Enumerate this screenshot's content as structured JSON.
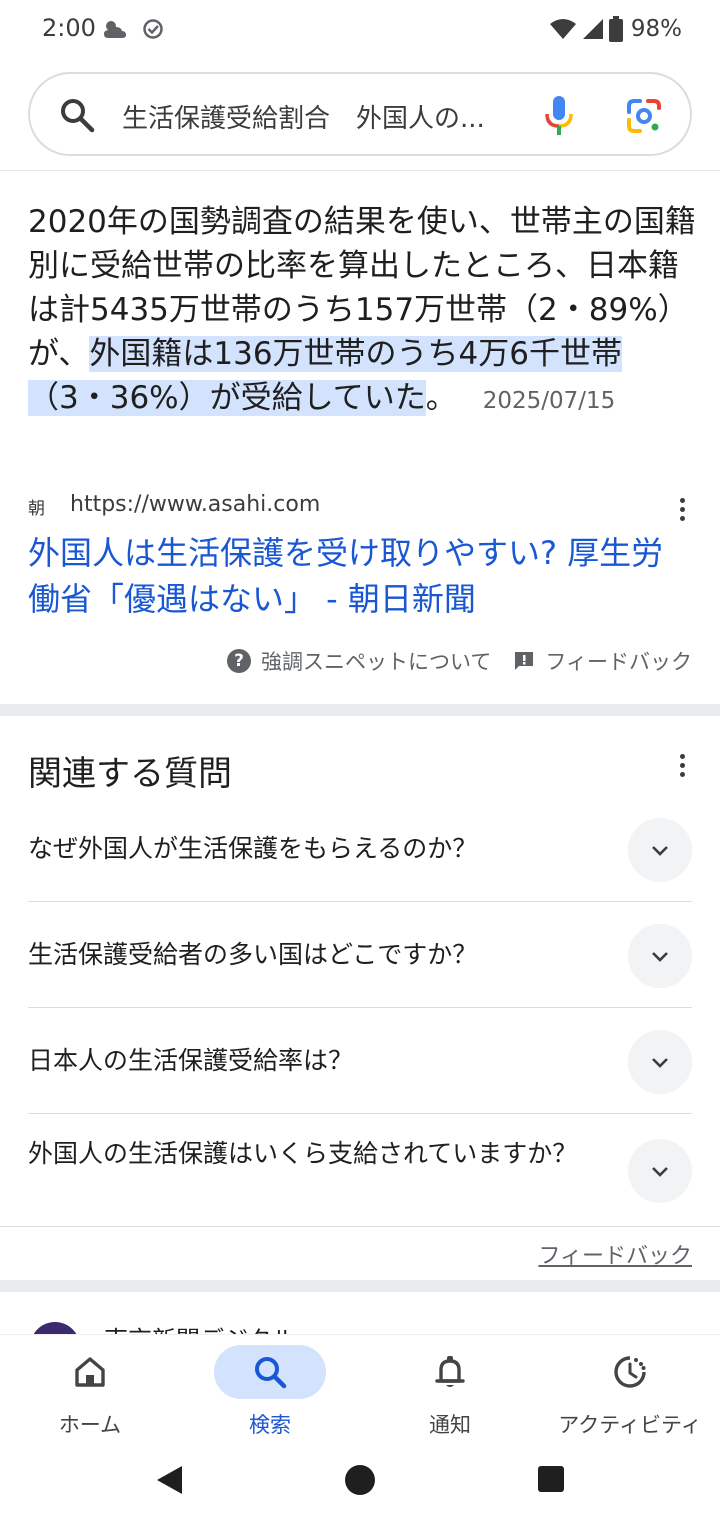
{
  "status": {
    "time": "2:00",
    "battery": "98%"
  },
  "search": {
    "query": "生活保護受給割合　外国人の..."
  },
  "snippet": {
    "text_before": "2020年の国勢調査の結果を使い、世帯主の国籍別に受給世帯の比率を算出したところ、日本籍は計5435万世帯のうち157万世帯（2・89%）が、",
    "text_highlight": "外国籍は136万世帯のうち4万6千世帯（3・36%）が受給していた",
    "text_after": "。",
    "date": "2025/07/15",
    "favicon": "朝",
    "url": "https://www.asahi.com",
    "title": "外国人は生活保護を受け取りやすい? 厚生労働省「優遇はない」 - 朝日新聞",
    "about_label": "強調スニペットについて",
    "feedback_label": "フィードバック"
  },
  "related": {
    "title": "関連する質問",
    "questions": [
      "なぜ外国人が生活保護をもらえるのか？",
      "生活保護受給者の多い国はどこですか？",
      "日本人の生活保護受給率は？",
      "外国人の生活保護はいくら支給されていますか？"
    ],
    "feedback_label": "フィードバック"
  },
  "next_result": {
    "source": "東京新聞デジタル"
  },
  "nav": {
    "items": [
      {
        "label": "ホーム",
        "icon": "home-icon"
      },
      {
        "label": "検索",
        "icon": "search-icon",
        "active": true
      },
      {
        "label": "通知",
        "icon": "bell-icon"
      },
      {
        "label": "アクティビティ",
        "icon": "activity-icon"
      }
    ]
  },
  "colors": {
    "link": "#1a57d3",
    "highlight": "#d3e3fd",
    "active_pill": "#d3e3fd"
  }
}
